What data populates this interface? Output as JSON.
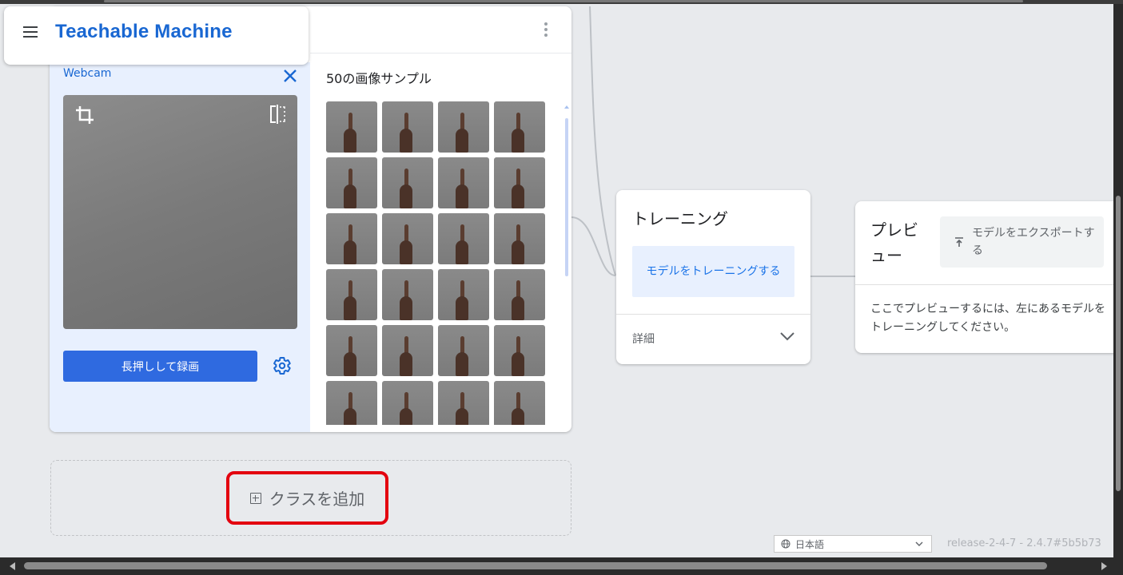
{
  "app": {
    "title": "Teachable Machine"
  },
  "class_card": {
    "webcam_label": "Webcam",
    "record_label": "長押しして録画",
    "samples_label": "50の画像サンプル",
    "sample_count": 50
  },
  "add_class": {
    "label": "クラスを追加"
  },
  "training": {
    "title": "トレーニング",
    "train_button": "モデルをトレーニングする",
    "details_label": "詳細"
  },
  "preview": {
    "title": "プレビュー",
    "export_button": "モデルをエクスポートする",
    "description": "ここでプレビューするには、左にあるモデルをトレーニングしてください。"
  },
  "footer": {
    "language": "日本語",
    "release": "release-2-4-7 - 2.4.7#5b5b73"
  },
  "colors": {
    "brand": "#1967d2",
    "record_button": "#2f6ae0",
    "webcam_panel": "#e8f0fe",
    "highlight_border": "#e3000f"
  }
}
